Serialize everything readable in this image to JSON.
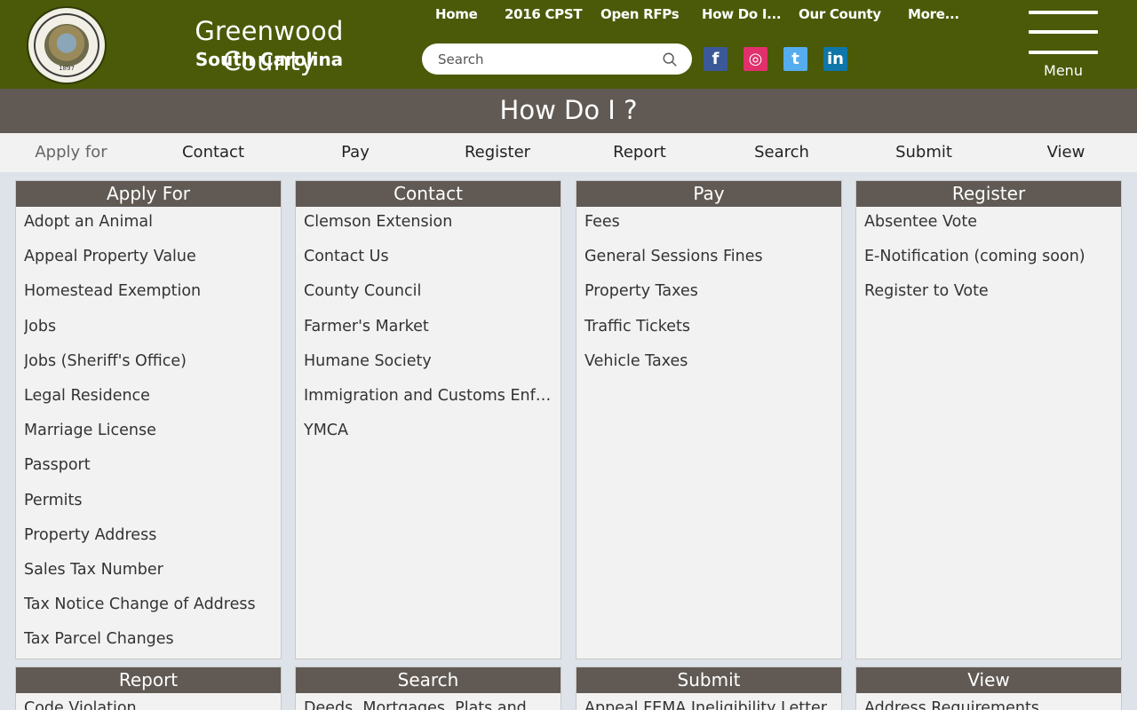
{
  "site": {
    "title": "Greenwood County",
    "subtitle": "South Carolina",
    "seal_year": "1897"
  },
  "topnav": [
    "Home",
    "2016 CPST",
    "Open RFPs",
    "How Do I...",
    "Our County",
    "More..."
  ],
  "search": {
    "placeholder": "Search"
  },
  "social": [
    {
      "icon": "facebook-icon",
      "glyph": "f"
    },
    {
      "icon": "instagram-icon",
      "glyph": "◎"
    },
    {
      "icon": "twitter-icon",
      "glyph": "t"
    },
    {
      "icon": "linkedin-icon",
      "glyph": "in"
    }
  ],
  "menu": {
    "label": "Menu"
  },
  "page": {
    "title": "How Do I ?"
  },
  "tabs": [
    "Apply for",
    "Contact",
    "Pay",
    "Register",
    "Report",
    "Search",
    "Submit",
    "View"
  ],
  "panels": [
    {
      "title": "Apply For",
      "items": [
        "Adopt an Animal",
        "Appeal Property Value",
        "Homestead Exemption",
        "Jobs",
        "Jobs (Sheriff's Office)",
        "Legal Residence",
        "Marriage License",
        "Passport",
        "Permits",
        "Property Address",
        "Sales Tax Number",
        "Tax Notice Change of Address",
        "Tax Parcel Changes"
      ]
    },
    {
      "title": "Contact",
      "items": [
        "Clemson Extension",
        "Contact Us",
        "County Council",
        "Farmer's Market",
        "Humane Society",
        "Immigration and Customs Enforcement",
        "YMCA"
      ]
    },
    {
      "title": "Pay",
      "items": [
        "Fees",
        "General Sessions Fines",
        "Property Taxes",
        "Traffic Tickets",
        "Vehicle Taxes"
      ]
    },
    {
      "title": "Register",
      "items": [
        "Absentee Vote",
        "E-Notification (coming soon)",
        "Register to Vote"
      ]
    },
    {
      "title": "Report",
      "items": [
        "Code Violation"
      ]
    },
    {
      "title": "Search",
      "items": [
        "Deeds, Mortgages, Plats and Other Records"
      ]
    },
    {
      "title": "Submit",
      "items": [
        "Appeal FEMA Ineligibility Letter"
      ]
    },
    {
      "title": "View",
      "items": [
        "Address Requirements"
      ]
    }
  ],
  "colors": {
    "header_bg": "#4a5a08",
    "band_bg": "#615a54",
    "page_bg": "#dde3e8",
    "panel_bg": "#f2f2f2"
  }
}
